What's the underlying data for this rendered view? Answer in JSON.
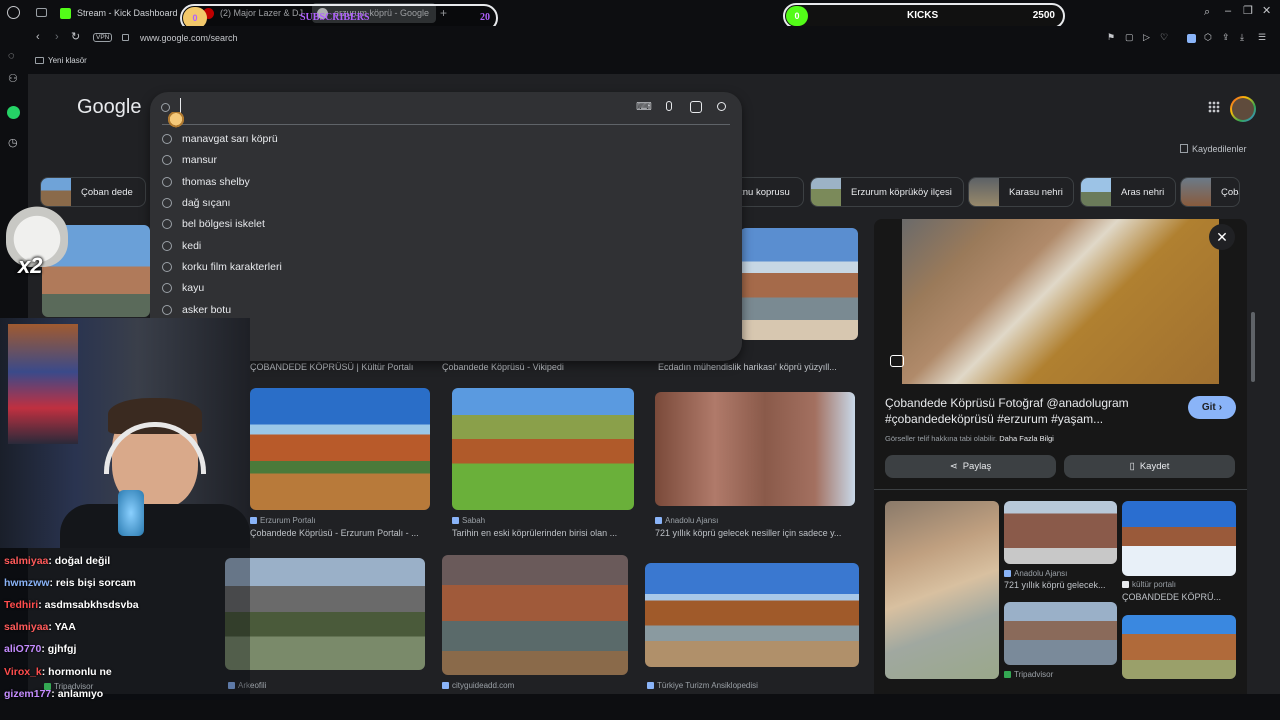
{
  "tabs": [
    {
      "label": "Stream - Kick Dashboard"
    },
    {
      "label": "(2) Major Lazer & DJ"
    },
    {
      "label": "erzurum köprü - Google"
    }
  ],
  "overlay": {
    "subs_label": "SUBSCRIBERS",
    "subs_left": "0",
    "subs_right": "20",
    "kicks_label": "KICKS",
    "kicks_left": "0",
    "kicks_right": "2500",
    "multiplier": "x2"
  },
  "address": {
    "vpn": "VPN",
    "url": "www.google.com/search"
  },
  "bookmarks": [
    {
      "label": "Yeni klasör"
    }
  ],
  "google": {
    "logo": "Google",
    "search_value": "",
    "saved_label": "Kaydedilenler"
  },
  "suggestions": [
    "manavgat sarı köprü",
    "mansur",
    "thomas shelby",
    "dağ sıçanı",
    "bel bölgesi iskelet",
    "kedi",
    "korku film karakterleri",
    "kayu",
    "asker botu"
  ],
  "chips": [
    "Çoban dede",
    "znu koprusu",
    "Erzurum köprüköy ilçesi",
    "Karasu nehri",
    "Aras nehri",
    "Çoban k"
  ],
  "results": {
    "row1": [
      {
        "caption": "ÇOBANDEDE KÖPRÜSÜ | Kültür Portalı"
      },
      {
        "caption": "Çobandede Köprüsü - Vikipedi"
      },
      {
        "caption": "Ecdadın mühendislik harikası' köprü yüzyıll..."
      }
    ],
    "row2": [
      {
        "source": "Erzurum Portalı",
        "caption": "Çobandede Köprüsü - Erzurum Portalı - ..."
      },
      {
        "source": "Sabah",
        "caption": "Tarihin en eski köprülerinden birisi olan ..."
      },
      {
        "source": "Anadolu Ajansı",
        "caption": "721 yıllık köprü gelecek nesiller için sadece y..."
      }
    ],
    "row3": [
      {
        "source": "Tripadvisor"
      },
      {
        "source": "Arkeofili"
      },
      {
        "source": "cityguideadd.com"
      },
      {
        "source": "Türkiye Turizm Ansiklopedisi"
      }
    ]
  },
  "preview": {
    "title": "Çobandede Köprüsü Fotoğraf @anadolugram #çobandedeköprüsü #erzurum #yaşam...",
    "go_label": "Git",
    "notice": "Görseller telif hakkına tabi olabilir.",
    "more_info": "Daha Fazla Bilgi",
    "share_label": "Paylaş",
    "save_label": "Kaydet",
    "related": [
      {
        "source": "Anadolu Ajansı",
        "caption": "721 yıllık köprü gelecek..."
      },
      {
        "source": "kültür portalı",
        "caption": "ÇOBANDEDE KÖPRÜ..."
      },
      {
        "source": "Tripadvisor",
        "caption": ""
      }
    ]
  },
  "chat": [
    {
      "user": "salmiyaa",
      "msg": ": doğal değil",
      "color": "#ff5a5a"
    },
    {
      "user": "hwmzww",
      "msg": ": reis bişi sorcam",
      "color": "#8ab4f8"
    },
    {
      "user": "Tedhiri",
      "msg": ": asdmsabkhsdsvba",
      "color": "#ff4d4d"
    },
    {
      "user": "salmiyaa",
      "msg": ": YAA",
      "color": "#ff5a5a"
    },
    {
      "user": "aliO770",
      "msg": ": gjhfgj",
      "color": "#c48cff"
    },
    {
      "user": "Virox_k",
      "msg": ": hormonlu ne",
      "color": "#ff4d4d"
    },
    {
      "user": "gizem177",
      "msg": ": anlamıyo",
      "color": "#c48cff"
    }
  ],
  "colors": {
    "accent": "#8ab4f8",
    "kick_green": "#53fc18",
    "page_bg": "#202124"
  }
}
